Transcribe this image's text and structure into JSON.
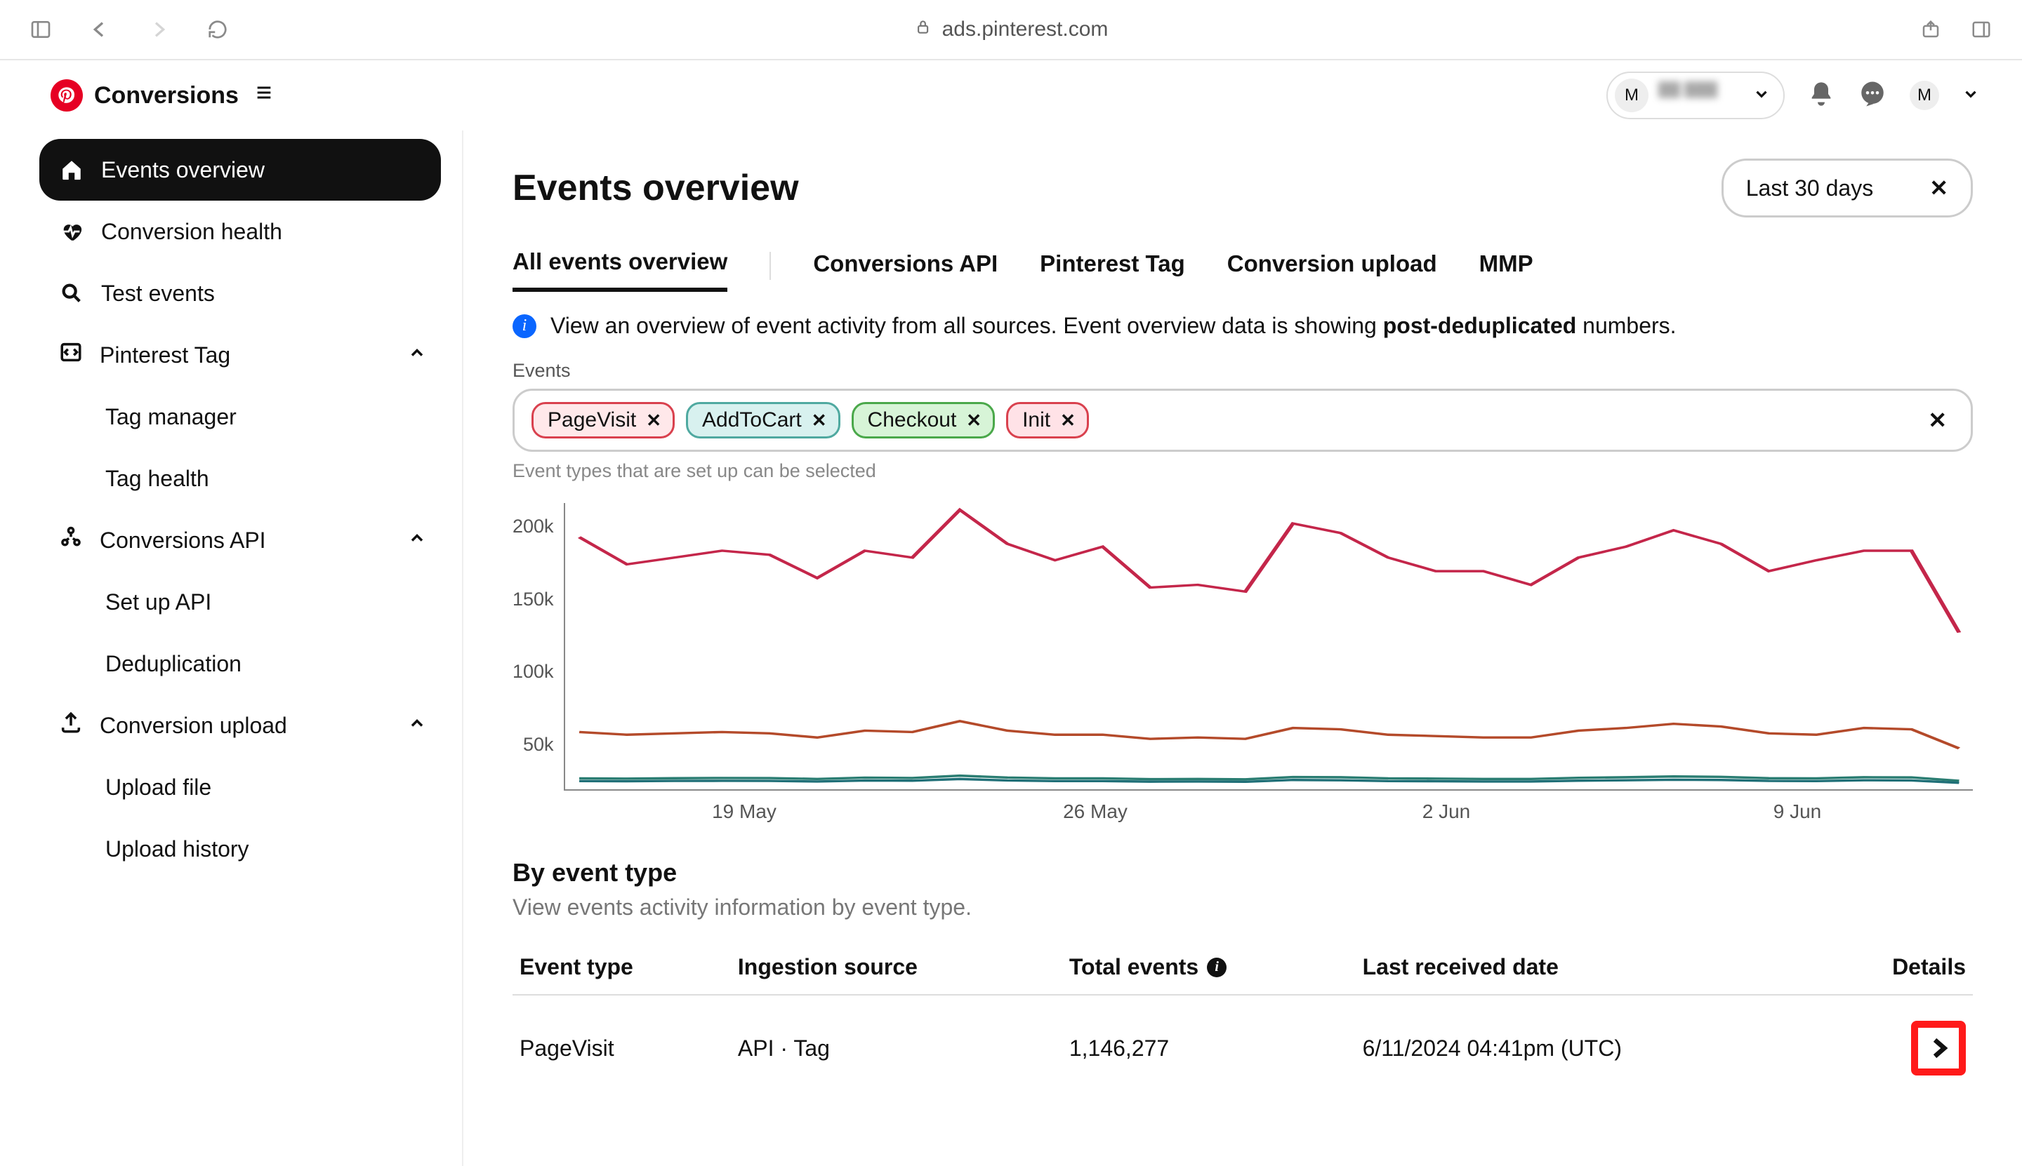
{
  "browser": {
    "url": "ads.pinterest.com"
  },
  "topbar": {
    "brand": "Conversions",
    "account_initial": "M",
    "user_initial": "M"
  },
  "sidebar": {
    "items": [
      {
        "label": "Events overview",
        "icon": "home-icon",
        "active": true
      },
      {
        "label": "Conversion health",
        "icon": "heartbeat-icon"
      },
      {
        "label": "Test events",
        "icon": "magnifier-icon"
      }
    ],
    "groups": [
      {
        "label": "Pinterest Tag",
        "icon": "tag-code-icon",
        "children": [
          {
            "label": "Tag manager"
          },
          {
            "label": "Tag health"
          }
        ]
      },
      {
        "label": "Conversions API",
        "icon": "api-icon",
        "children": [
          {
            "label": "Set up API"
          },
          {
            "label": "Deduplication"
          }
        ]
      },
      {
        "label": "Conversion upload",
        "icon": "upload-icon",
        "children": [
          {
            "label": "Upload file"
          },
          {
            "label": "Upload history"
          }
        ]
      }
    ]
  },
  "page": {
    "title": "Events overview",
    "date_range": "Last 30 days",
    "tabs": [
      {
        "label": "All events overview",
        "active": true
      },
      {
        "label": "Conversions API"
      },
      {
        "label": "Pinterest Tag"
      },
      {
        "label": "Conversion upload"
      },
      {
        "label": "MMP"
      }
    ],
    "info_prefix": "View an overview of event activity from all sources. Event overview data is showing ",
    "info_bold": "post-deduplicated",
    "info_suffix": " numbers.",
    "events_label": "Events",
    "filters": [
      {
        "label": "PageVisit",
        "cls": "red"
      },
      {
        "label": "AddToCart",
        "cls": "teal"
      },
      {
        "label": "Checkout",
        "cls": "green"
      },
      {
        "label": "Init",
        "cls": "pink"
      }
    ],
    "filter_hint": "Event types that are set up can be selected"
  },
  "chart_data": {
    "type": "line",
    "title": "",
    "xlabel": "",
    "ylabel": "",
    "ylim": [
      0,
      210000
    ],
    "y_ticks": [
      "200k",
      "150k",
      "100k",
      "50k"
    ],
    "x_ticks": [
      "19 May",
      "26 May",
      "2 Jun",
      "9 Jun"
    ],
    "x": [
      0,
      1,
      2,
      3,
      4,
      5,
      6,
      7,
      8,
      9,
      10,
      11,
      12,
      13,
      14,
      15,
      16,
      17,
      18,
      19,
      20,
      21,
      22,
      23,
      24,
      25,
      26,
      27,
      28,
      29
    ],
    "series": [
      {
        "name": "PageVisit",
        "color": "#c4264a",
        "values": [
          185000,
          165000,
          170000,
          175000,
          172000,
          155000,
          175000,
          170000,
          205000,
          180000,
          168000,
          178000,
          148000,
          150000,
          145000,
          195000,
          188000,
          170000,
          160000,
          160000,
          150000,
          170000,
          178000,
          190000,
          180000,
          160000,
          168000,
          175000,
          175000,
          115000
        ]
      },
      {
        "name": "AddToCart",
        "color": "#b44a2a",
        "values": [
          42000,
          40000,
          41000,
          42000,
          41000,
          38000,
          43000,
          42000,
          50000,
          43000,
          40000,
          40000,
          37000,
          38000,
          37000,
          45000,
          44000,
          40000,
          39000,
          38000,
          38000,
          43000,
          45000,
          48000,
          46000,
          41000,
          40000,
          45000,
          44000,
          30000
        ]
      },
      {
        "name": "Checkout",
        "color": "#2a7d72",
        "values": [
          8000,
          7800,
          8100,
          8300,
          8200,
          7600,
          8500,
          8300,
          10000,
          8600,
          8000,
          8000,
          7400,
          7500,
          7300,
          9000,
          8800,
          8000,
          7800,
          7600,
          7600,
          8400,
          8800,
          9400,
          9100,
          8100,
          8000,
          8800,
          8700,
          6200
        ]
      },
      {
        "name": "Init",
        "color": "#1f6f77",
        "values": [
          6000,
          5900,
          6100,
          6200,
          6100,
          5700,
          6400,
          6300,
          7500,
          6500,
          6000,
          6000,
          5600,
          5700,
          5500,
          6800,
          6600,
          6000,
          5900,
          5700,
          5700,
          6300,
          6600,
          7000,
          6800,
          6100,
          6000,
          6600,
          6500,
          4700
        ]
      }
    ]
  },
  "by_event": {
    "title": "By event type",
    "subtitle": "View events activity information by event type.",
    "columns": [
      "Event type",
      "Ingestion source",
      "Total events",
      "Last received date",
      "Details"
    ],
    "rows": [
      {
        "event_type": "PageVisit",
        "ingestion": "API · Tag",
        "total": "1,146,277",
        "last": "6/11/2024 04:41pm (UTC)"
      }
    ]
  }
}
